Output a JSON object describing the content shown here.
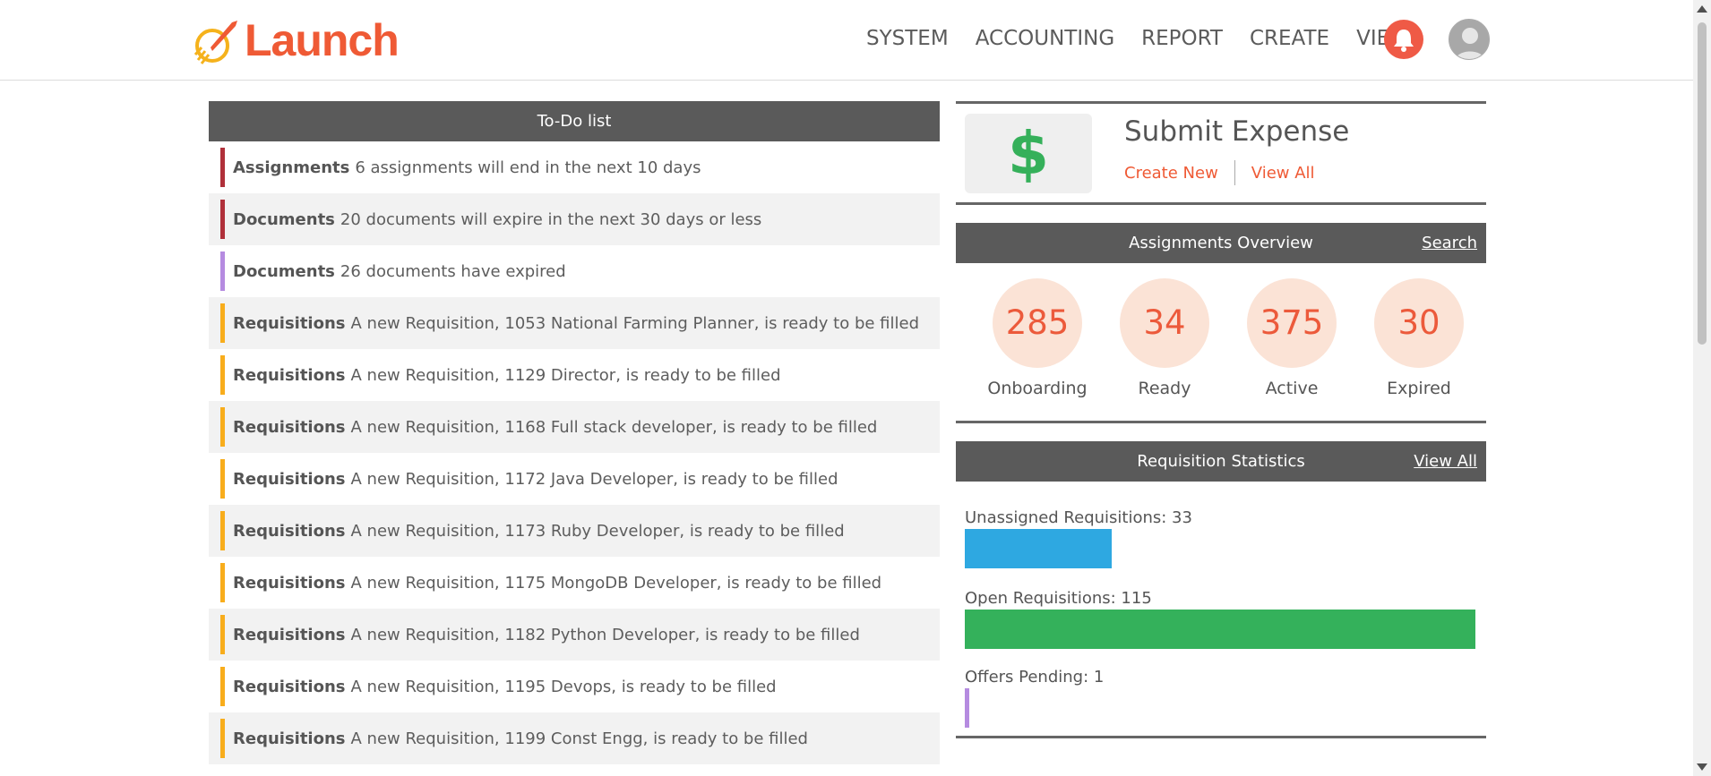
{
  "app": {
    "logo_text": "Launch"
  },
  "nav": [
    "SYSTEM",
    "ACCOUNTING",
    "REPORT",
    "CREATE",
    "VIEW"
  ],
  "todo": {
    "title": "To-Do list",
    "items": [
      {
        "category": "Assignments",
        "text": "6 assignments will end in the next 10 days",
        "color": "#b0303a"
      },
      {
        "category": "Documents",
        "text": "20 documents will expire in the next 30 days or less",
        "color": "#b0303a"
      },
      {
        "category": "Documents",
        "text": "26 documents have expired",
        "color": "#b58be0"
      },
      {
        "category": "Requisitions",
        "text": "A new Requisition, 1053 National Farming Planner, is ready to be filled",
        "color": "#f8ad1c"
      },
      {
        "category": "Requisitions",
        "text": "A new Requisition, 1129 Director, is ready to be filled",
        "color": "#f8ad1c"
      },
      {
        "category": "Requisitions",
        "text": "A new Requisition, 1168 Full stack developer, is ready to be filled",
        "color": "#f8ad1c"
      },
      {
        "category": "Requisitions",
        "text": "A new Requisition, 1172 Java Developer, is ready to be filled",
        "color": "#f8ad1c"
      },
      {
        "category": "Requisitions",
        "text": "A new Requisition, 1173 Ruby Developer, is ready to be filled",
        "color": "#f8ad1c"
      },
      {
        "category": "Requisitions",
        "text": "A new Requisition, 1175 MongoDB Developer, is ready to be filled",
        "color": "#f8ad1c"
      },
      {
        "category": "Requisitions",
        "text": "A new Requisition, 1182 Python Developer, is ready to be filled",
        "color": "#f8ad1c"
      },
      {
        "category": "Requisitions",
        "text": "A new Requisition, 1195 Devops, is ready to be filled",
        "color": "#f8ad1c"
      },
      {
        "category": "Requisitions",
        "text": "A new Requisition, 1199 Const Engg, is ready to be filled",
        "color": "#f8ad1c"
      }
    ]
  },
  "expense": {
    "title": "Submit Expense",
    "icon": "dollar-icon",
    "icon_glyph": "$",
    "create_new": "Create New",
    "view_all": "View All"
  },
  "overview": {
    "title": "Assignments Overview",
    "search": "Search",
    "stats": [
      {
        "value": "285",
        "label": "Onboarding"
      },
      {
        "value": "34",
        "label": "Ready"
      },
      {
        "value": "375",
        "label": "Active"
      },
      {
        "value": "30",
        "label": "Expired"
      }
    ]
  },
  "requisitions": {
    "title": "Requisition Statistics",
    "view_all": "View All",
    "rows": [
      {
        "label": "Unassigned Requisitions: 33",
        "value": 33,
        "color": "#2ea8e1"
      },
      {
        "label": "Open Requisitions: 115",
        "value": 115,
        "color": "#34b15b"
      },
      {
        "label": "Offers Pending: 1",
        "value": 1,
        "color": "#b58be0"
      }
    ]
  }
}
